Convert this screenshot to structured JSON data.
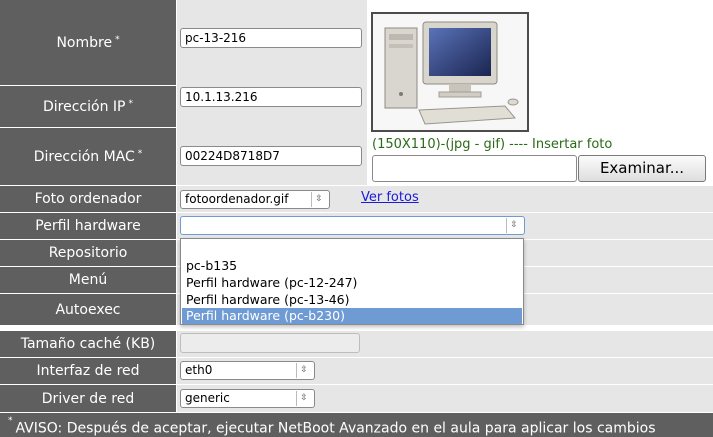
{
  "form": {
    "nombre_label": "Nombre",
    "nombre_value": "pc-13-216",
    "ip_label": "Dirección IP",
    "ip_value": "10.1.13.216",
    "mac_label": "Dirección MAC",
    "mac_value": "00224D8718D7",
    "required_mark": "*",
    "foto_label": "Foto ordenador",
    "foto_value": "fotoordenador.gif",
    "ver_fotos_link": "Ver fotos",
    "perfil_label": "Perfil hardware",
    "perfil_value": "",
    "repositorio_label": "Repositorio",
    "menu_label": "Menú",
    "autoexec_label": "Autoexec",
    "cache_label": "Tamaño caché (KB)",
    "cache_value": "",
    "interfaz_label": "Interfaz de red",
    "interfaz_value": "eth0",
    "driver_label": "Driver de red",
    "driver_value": "generic",
    "photo_hint": "(150X110)-(jpg - gif) ---- Insertar foto",
    "browse_button": "Examinar..."
  },
  "perfil_dropdown": {
    "options": [
      "",
      "pc-b135",
      "Perfil hardware (pc-12-247)",
      "Perfil hardware (pc-13-46)",
      "Perfil hardware (pc-b230)"
    ],
    "highlighted_index": 4
  },
  "footer": {
    "mark": "*",
    "notice": "AVISO: Después de aceptar, ejecutar NetBoot Avanzado en el aula para aplicar los cambios"
  },
  "icons": {
    "select_arrow": "updown-arrows-icon",
    "computer_photo": "desktop-computer-icon"
  },
  "colors": {
    "label_bg": "#5f5f5f",
    "value_bg": "#e6e6e6",
    "hint_text": "#2a6b18",
    "link": "#1a1ad8",
    "highlight": "#6f9bd4"
  }
}
